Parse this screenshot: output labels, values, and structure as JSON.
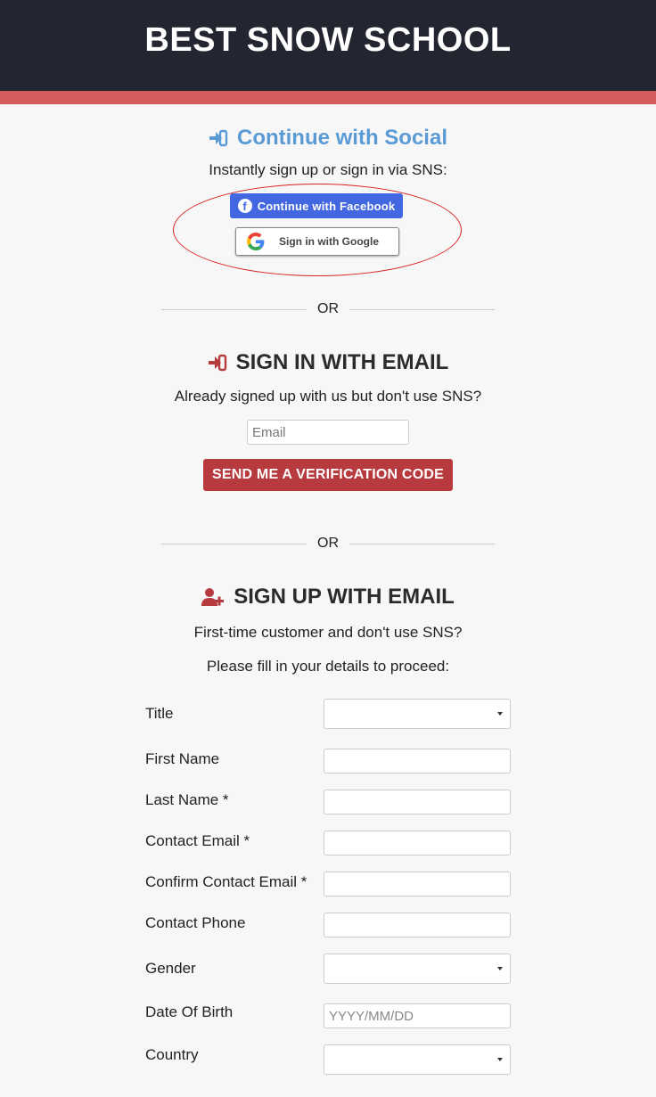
{
  "header": {
    "title": "BEST SNOW SCHOOL"
  },
  "social": {
    "title": "Continue with Social",
    "subtitle": "Instantly sign up or sign in via SNS:",
    "facebook_label": "Continue with Facebook",
    "google_label": "Sign in with Google"
  },
  "divider": {
    "or": "OR"
  },
  "signin": {
    "title": "SIGN IN WITH EMAIL",
    "subtitle": "Already signed up with us but don't use SNS?",
    "email_placeholder": "Email",
    "button_label": "SEND ME A VERIFICATION CODE"
  },
  "signup": {
    "title": "SIGN UP WITH EMAIL",
    "subtitle1": "First-time customer and don't use SNS?",
    "subtitle2": "Please fill in your details to proceed:",
    "fields": {
      "title": {
        "label": "Title",
        "value": ""
      },
      "first_name": {
        "label": "First Name",
        "value": ""
      },
      "last_name": {
        "label": "Last Name *",
        "value": ""
      },
      "contact_email": {
        "label": "Contact Email *",
        "value": ""
      },
      "confirm_email": {
        "label": "Confirm Contact Email *",
        "value": ""
      },
      "contact_phone": {
        "label": "Contact Phone",
        "value": ""
      },
      "gender": {
        "label": "Gender",
        "value": ""
      },
      "dob": {
        "label": "Date Of Birth",
        "placeholder": "YYYY/MM/DD",
        "value": ""
      },
      "country": {
        "label": "Country",
        "value": ""
      }
    }
  },
  "colors": {
    "header_bg": "#232630",
    "header_stripe": "#d45c5c",
    "social_accent": "#5b9bd5",
    "facebook": "#4267e0",
    "primary_button": "#b73a3f",
    "highlight_ring": "#d9211f"
  },
  "icons": {
    "social": "sign-in-icon",
    "signin": "sign-in-icon",
    "signup": "user-plus-icon",
    "facebook": "facebook-icon",
    "google": "google-icon",
    "select": "caret-down-icon"
  }
}
